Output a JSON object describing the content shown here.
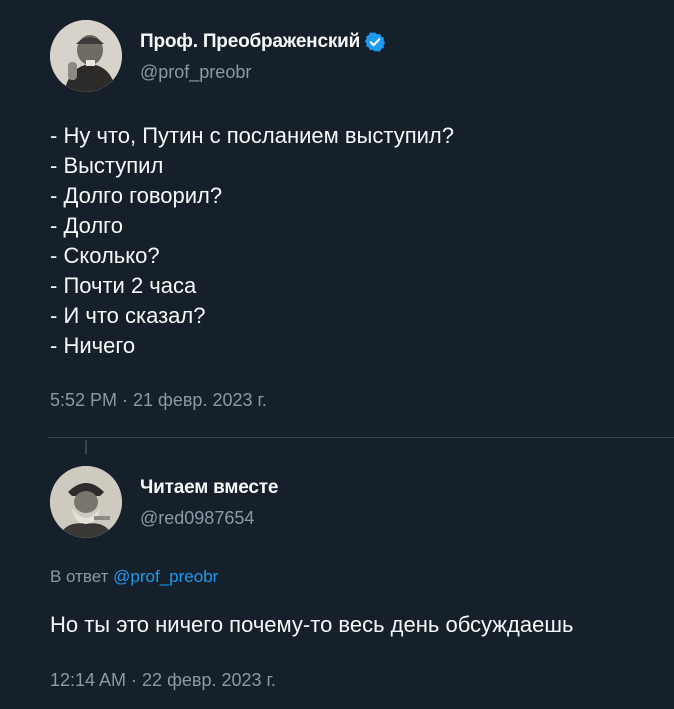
{
  "colors": {
    "background": "#15202b",
    "text_primary": "#f7f9f9",
    "text_secondary": "#8b98a5",
    "accent": "#1d9bf0",
    "divider": "#38444d"
  },
  "tweet": {
    "author": {
      "display_name": "Проф. Преображенский",
      "handle": "@prof_preobr",
      "verified_icon": "verified-badge-icon",
      "avatar_icon": "avatar-photo"
    },
    "text_lines": [
      "- Ну что, Путин с посланием выступил?",
      "- Выступил",
      "- Долго говорил?",
      "- Долго",
      "- Сколько?",
      "- Почти 2 часа",
      "- И что сказал?",
      "- Ничего"
    ],
    "timestamp": "5:52 PM · 21 февр. 2023 г."
  },
  "reply": {
    "author": {
      "display_name": "Читаем вместе",
      "handle": "@red0987654",
      "avatar_icon": "avatar-photo"
    },
    "reply_to_prefix": "В ответ ",
    "reply_to_mention": "@prof_preobr",
    "text": "Но ты это ничего почему-то весь день обсуждаешь",
    "timestamp": "12:14 AM · 22 февр. 2023 г."
  }
}
